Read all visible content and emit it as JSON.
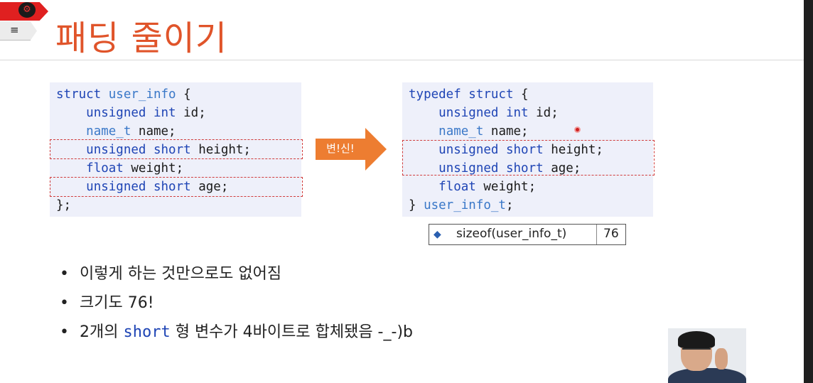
{
  "title": "패딩 줄이기",
  "left_code": {
    "lines": [
      [
        {
          "t": "struct ",
          "c": "kw"
        },
        {
          "t": "user_info",
          "c": "ty"
        },
        {
          "t": " {",
          "c": ""
        }
      ],
      [
        {
          "t": "    ",
          "c": ""
        },
        {
          "t": "unsigned int",
          "c": "kw"
        },
        {
          "t": " id;",
          "c": ""
        }
      ],
      [
        {
          "t": "    ",
          "c": ""
        },
        {
          "t": "name_t",
          "c": "ty"
        },
        {
          "t": " name;",
          "c": ""
        }
      ],
      [
        {
          "t": "    ",
          "c": ""
        },
        {
          "t": "unsigned short",
          "c": "kw"
        },
        {
          "t": " height;",
          "c": ""
        }
      ],
      [
        {
          "t": "    ",
          "c": ""
        },
        {
          "t": "float",
          "c": "kw"
        },
        {
          "t": " weight;",
          "c": ""
        }
      ],
      [
        {
          "t": "    ",
          "c": ""
        },
        {
          "t": "unsigned short",
          "c": "kw"
        },
        {
          "t": " age;",
          "c": ""
        }
      ],
      [
        {
          "t": "};",
          "c": ""
        }
      ]
    ]
  },
  "arrow_label": "변!신!",
  "right_code": {
    "lines": [
      [
        {
          "t": "typedef struct",
          "c": "kw"
        },
        {
          "t": " {",
          "c": ""
        }
      ],
      [
        {
          "t": "    ",
          "c": ""
        },
        {
          "t": "unsigned int",
          "c": "kw"
        },
        {
          "t": " id;",
          "c": ""
        }
      ],
      [
        {
          "t": "    ",
          "c": ""
        },
        {
          "t": "name_t",
          "c": "ty"
        },
        {
          "t": " name;",
          "c": ""
        }
      ],
      [
        {
          "t": "    ",
          "c": ""
        },
        {
          "t": "unsigned short",
          "c": "kw"
        },
        {
          "t": " height;",
          "c": ""
        }
      ],
      [
        {
          "t": "    ",
          "c": ""
        },
        {
          "t": "unsigned short",
          "c": "kw"
        },
        {
          "t": " age;",
          "c": ""
        }
      ],
      [
        {
          "t": "    ",
          "c": ""
        },
        {
          "t": "float",
          "c": "kw"
        },
        {
          "t": " weight;",
          "c": ""
        }
      ],
      [
        {
          "t": "} ",
          "c": ""
        },
        {
          "t": "user_info_t",
          "c": "ty"
        },
        {
          "t": ";",
          "c": ""
        }
      ]
    ]
  },
  "tooltip": {
    "expr": "sizeof(user_info_t)",
    "value": "76",
    "icon": "cube-icon"
  },
  "bullets": {
    "b1": "이렇게 하는 것만으로도 없어짐",
    "b2": "크기도 76!",
    "b3_pre": "2개의 ",
    "b3_code": "short",
    "b3_post": " 형 변수가 4바이트로 합체됐음 -_-)b"
  },
  "colors": {
    "title": "#e0542a",
    "keyword": "#1f45b5",
    "type": "#3a78c8",
    "arrow": "#ed7d31",
    "highlight": "#d03c3c",
    "code_bg": "#eef0fa"
  }
}
